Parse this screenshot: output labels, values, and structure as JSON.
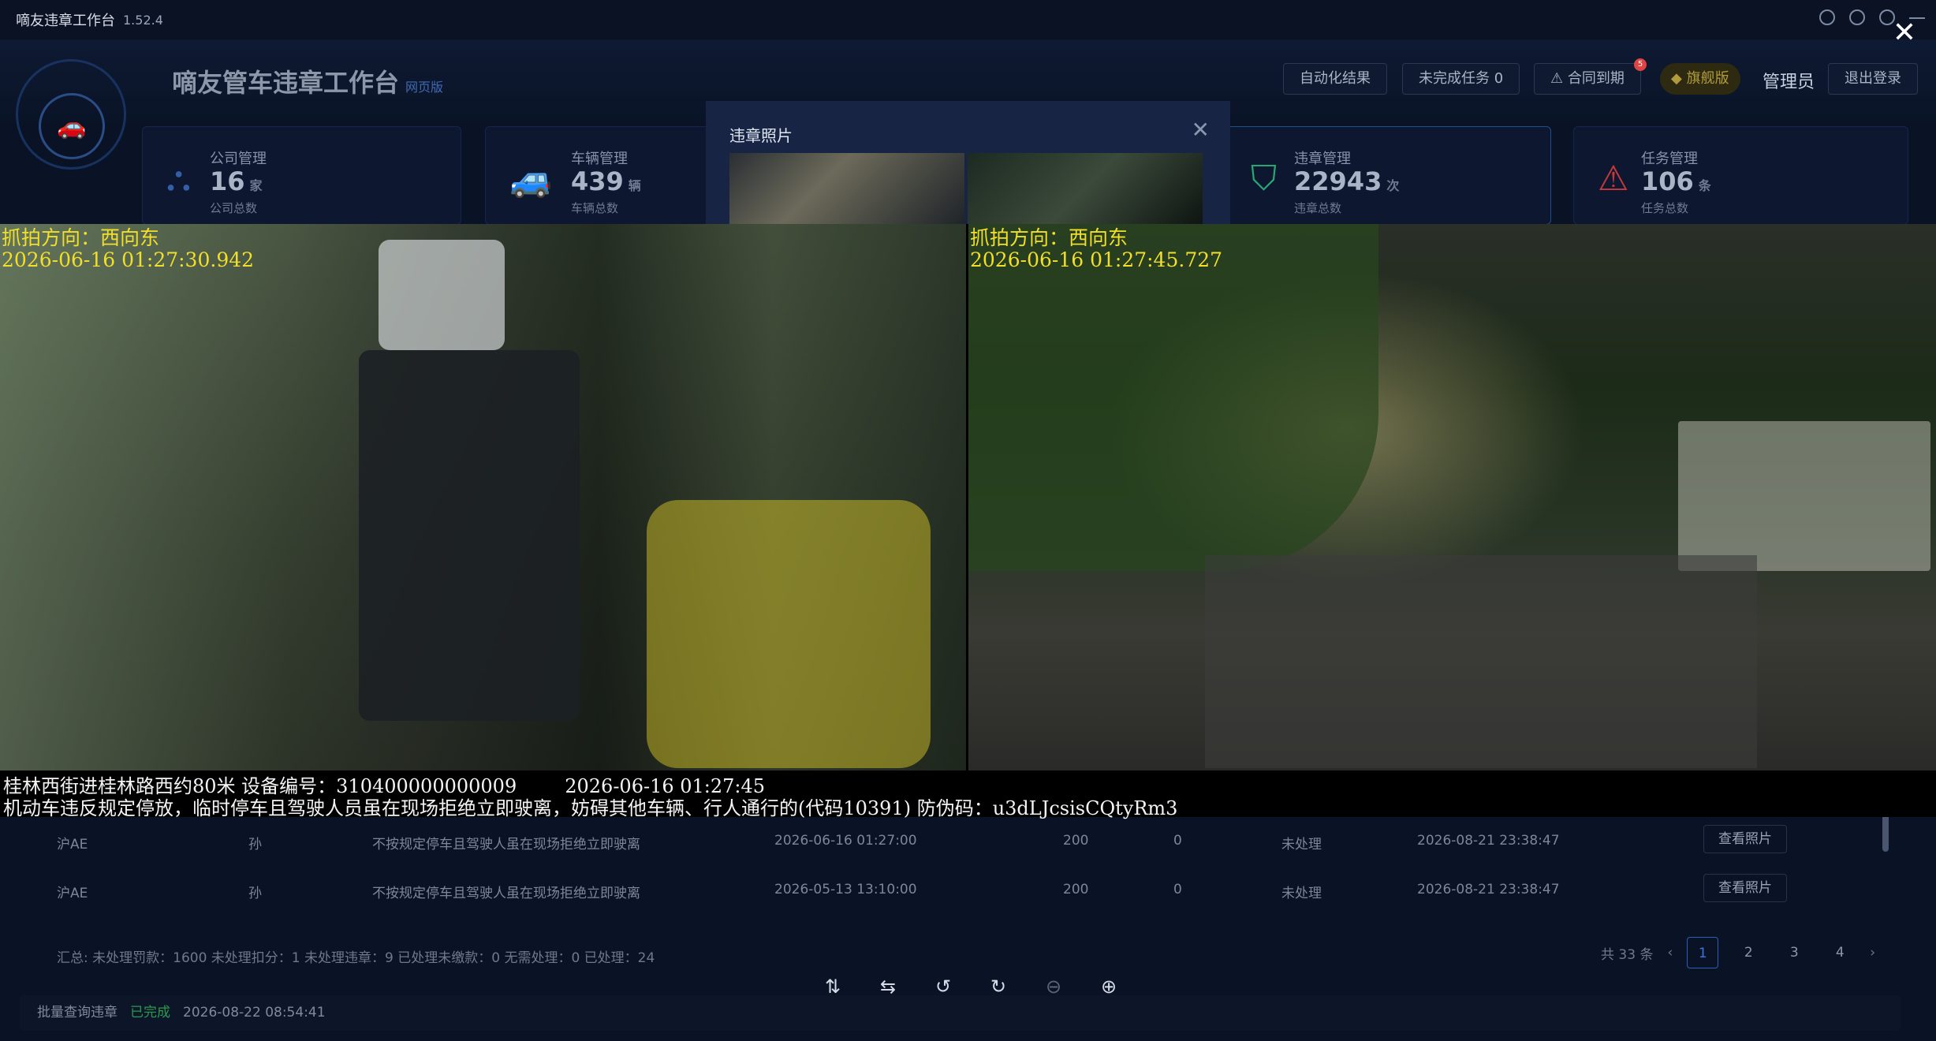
{
  "app": {
    "title": "嘀友违章工作台",
    "version": "1.52.4"
  },
  "header": {
    "title": "嘀友管车违章工作台",
    "badge": "网页版",
    "buttons": [
      "自动化结果",
      "未完成任务 0",
      "合同到期"
    ],
    "contract_badge_count": "5",
    "flag": "旗舰版",
    "admin": "管理员",
    "logout": "退出登录"
  },
  "stats": [
    {
      "label": "公司管理",
      "value": "16",
      "unit": "家",
      "sub": "公司总数",
      "icon": "company-icon"
    },
    {
      "label": "车辆管理",
      "value": "439",
      "unit": "辆",
      "sub": "车辆总数",
      "icon": "car-icon"
    },
    {
      "label": "违章管理",
      "value": "22943",
      "unit": "次",
      "sub": "违章总数",
      "icon": "shield-icon"
    },
    {
      "label": "任务管理",
      "value": "106",
      "unit": "条",
      "sub": "任务总数",
      "icon": "warning-icon"
    }
  ],
  "modal": {
    "title": "违章照片"
  },
  "viewer": {
    "left": {
      "direction": "抓拍方向：西向东",
      "time": "2026-06-16 01:27:30.942"
    },
    "right": {
      "direction": "抓拍方向：西向东",
      "time": "2026-06-16 01:27:45.727"
    },
    "caption_line1": "桂林西街进桂林路西约80米 设备编号：310400000000009        2026-06-16 01:27:45",
    "caption_line2": "机动车违反规定停放，临时停车且驾驶人员虽在现场拒绝立即驶离，妨碍其他车辆、行人通行的(代码10391) 防伪码：u3dLJcsisCQtyRm3"
  },
  "table": {
    "rows": [
      {
        "plate": "沪AE",
        "name": "孙",
        "desc": "不按规定停车且驾驶人虽在现场拒绝立即驶离",
        "time": "2026-06-16 01:27:00",
        "fine": "200",
        "points": "0",
        "status": "未处理",
        "updated": "2026-08-21 23:38:47",
        "action": "查看照片"
      },
      {
        "plate": "沪AE",
        "name": "孙",
        "desc": "不按规定停车且驾驶人虽在现场拒绝立即驶离",
        "time": "2026-05-13 13:10:00",
        "fine": "200",
        "points": "0",
        "status": "未处理",
        "updated": "2026-08-21 23:38:47",
        "action": "查看照片"
      }
    ]
  },
  "summary": "汇总:   未处理罚款：1600   未处理扣分：1   未处理违章：9   已处理未缴款：0   无需处理：0   已处理：24",
  "pager": {
    "total": "共 33 条",
    "pages": [
      "1",
      "2",
      "3",
      "4"
    ]
  },
  "footer": {
    "task": "批量查询违章",
    "status": "已完成",
    "time": "2026-08-22 08:54:41"
  }
}
